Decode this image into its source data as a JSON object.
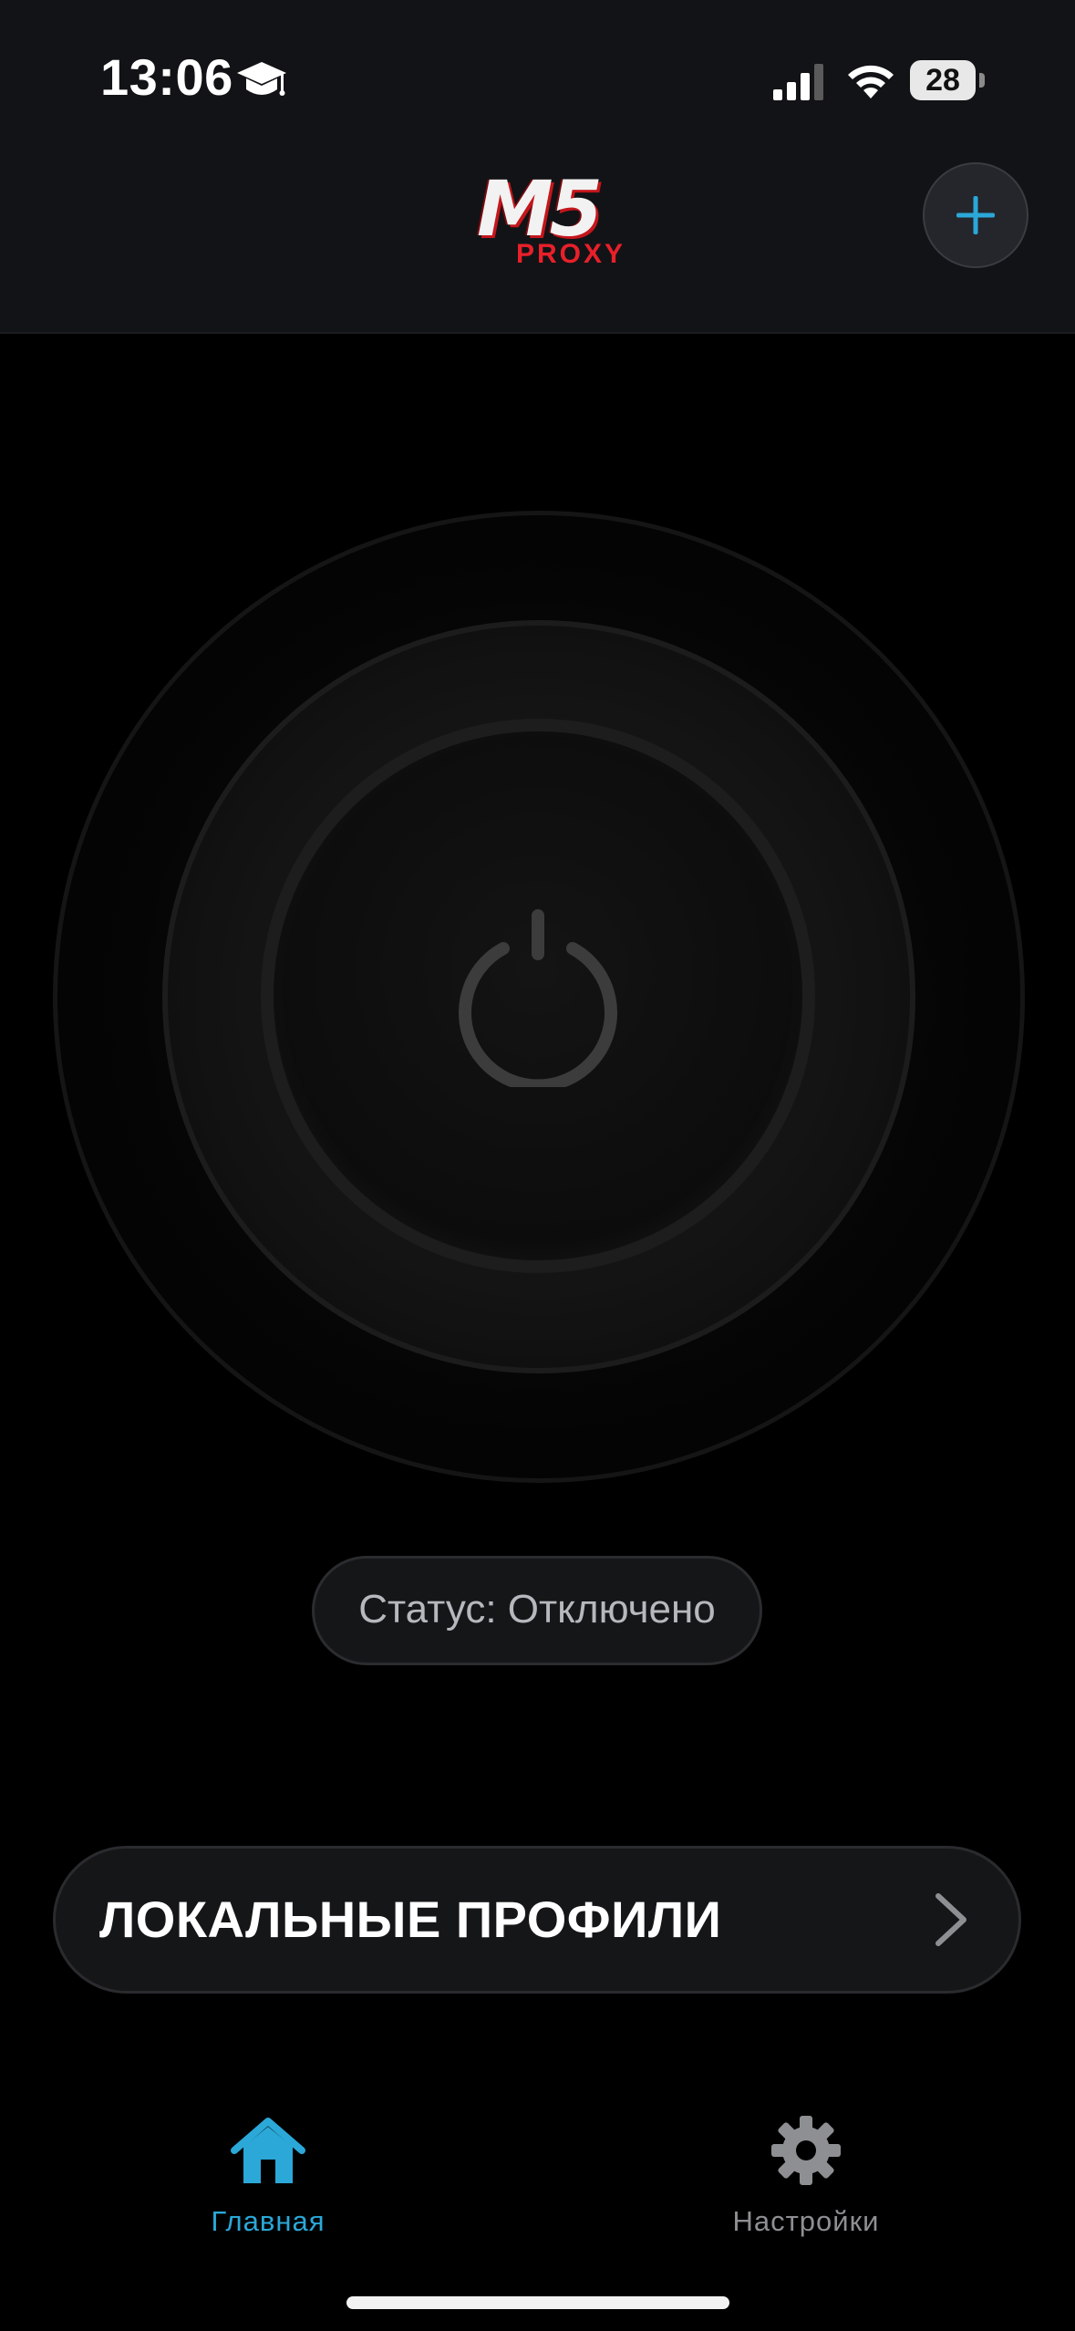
{
  "status_bar": {
    "time": "13:06",
    "battery_level": "28",
    "icons": [
      "graduation-cap-icon",
      "cellular-signal-icon",
      "wifi-icon",
      "battery-icon"
    ]
  },
  "header": {
    "logo_main": "M5",
    "logo_sub": "PROXY",
    "add_button_icon": "plus-icon"
  },
  "power": {
    "icon": "power-icon",
    "state": "off"
  },
  "status": {
    "text": "Статус: Отключено"
  },
  "profiles": {
    "label": "ЛОКАЛЬНЫЕ ПРОФИЛИ",
    "icon": "chevron-right-icon"
  },
  "tabbar": {
    "tabs": [
      {
        "label": "Главная",
        "icon": "home-icon",
        "active": true
      },
      {
        "label": "Настройки",
        "icon": "gear-icon",
        "active": false
      }
    ]
  },
  "colors": {
    "accent": "#2ba8d8",
    "background": "#000000",
    "header_bg": "#121316",
    "logo_red": "#e8202a"
  }
}
